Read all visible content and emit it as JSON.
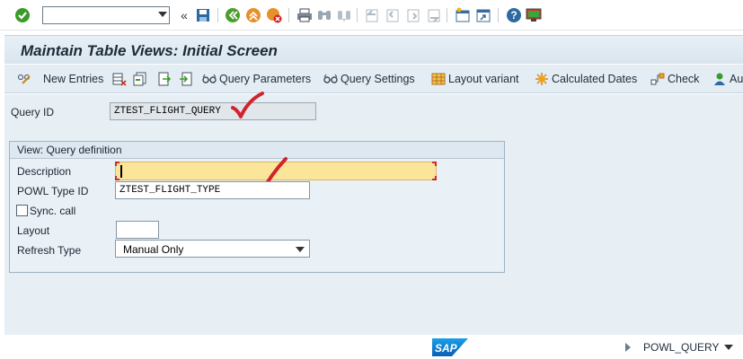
{
  "systoolbar": {
    "command_value": "",
    "icons": [
      "enter-icon",
      "command-dropdown-icon",
      "collapse-icon",
      "save-icon",
      "back-icon",
      "exit-icon",
      "cancel-icon",
      "print-icon",
      "find-icon",
      "find-next-icon",
      "first-page-icon",
      "previous-page-icon",
      "next-page-icon",
      "last-page-icon",
      "create-session-icon",
      "shortcut-icon",
      "help-icon",
      "customize-layout-icon"
    ]
  },
  "title": "Maintain Table Views: Initial Screen",
  "apptoolbar": {
    "new_entries": "New Entries",
    "query_parameters": "Query Parameters",
    "query_settings": "Query Settings",
    "layout_variant": "Layout variant",
    "calculated_dates": "Calculated Dates",
    "check": "Check",
    "truncated": "Au"
  },
  "form": {
    "query_id_label": "Query ID",
    "query_id_value": "ZTEST_FLIGHT_QUERY",
    "group_title": "View: Query definition",
    "description_label": "Description",
    "description_value": "",
    "powl_type_label": "POWL Type ID",
    "powl_type_value": "ZTEST_FLIGHT_TYPE",
    "sync_call_label": "Sync. call",
    "sync_call_checked": false,
    "layout_label": "Layout",
    "layout_value": "",
    "refresh_type_label": "Refresh Type",
    "refresh_type_value": "Manual Only"
  },
  "status": {
    "logo": "SAP",
    "program": "POWL_QUERY"
  },
  "colors": {
    "accent_red": "#d0242a",
    "highlight_field": "#fbe59b",
    "enter_green": "#3c9a2a"
  }
}
